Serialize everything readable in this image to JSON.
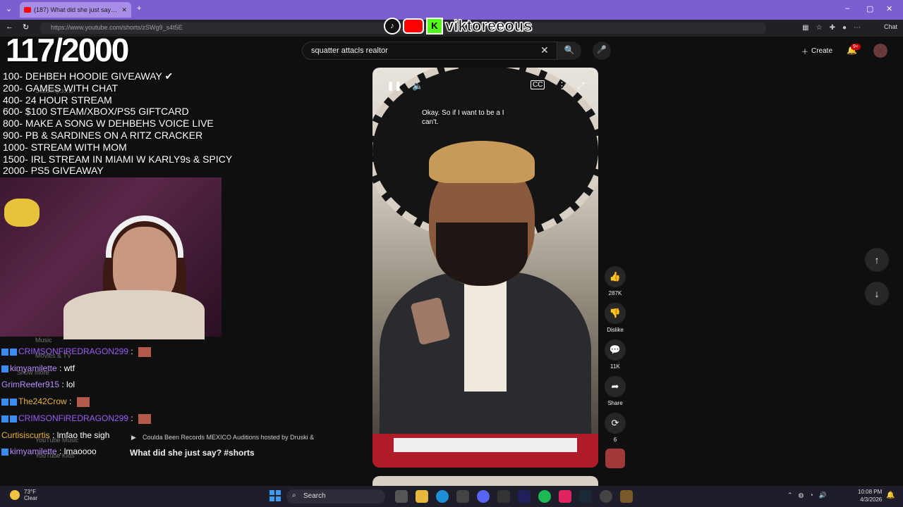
{
  "browser": {
    "tab_title": "(187) What did she just say? #",
    "url": "https://www.youtube.com/shorts/zSWg9_s4t5E",
    "chat_button": "Chat"
  },
  "youtube": {
    "search_value": "squatter attacls realtor",
    "create_label": "Create",
    "notif_count": "9+",
    "channel_line": "Coulda Been Records MEXICO Auditions hosted by Druski &",
    "video_title": "What did she just say? #shorts",
    "caption": "Okay. So if I want to be a I can't.",
    "actions": [
      {
        "icon": "thumb-up-icon",
        "glyph": "👍",
        "label": "287K"
      },
      {
        "icon": "thumb-down-icon",
        "glyph": "👎",
        "label": "Dislike"
      },
      {
        "icon": "comment-icon",
        "glyph": "💬",
        "label": "11K"
      },
      {
        "icon": "share-icon",
        "glyph": "➦",
        "label": "Share"
      },
      {
        "icon": "remix-icon",
        "glyph": "⟳",
        "label": "6"
      }
    ],
    "ghost_sidebar": [
      "Show more",
      "Music",
      "Movies & TV",
      "YouTube Music",
      "YouTube Kids",
      "Subscriptions"
    ]
  },
  "overlay": {
    "counter": "117/2000",
    "brand": "viktoreeous",
    "goals": [
      "100- DEHBEH HOODIE GIVEAWAY ✔",
      "200- GAMES WITH CHAT",
      "400- 24 HOUR STREAM",
      "600- $100 STEAM/XBOX/PS5 GIFTCARD",
      "800- MAKE A SONG W DEHBEHS VOICE LIVE",
      "900- PB & SARDINES ON A RITZ CRACKER",
      "1000- STREAM WITH MOM",
      "1500- IRL STREAM IN MIAMI W KARLY9s & SPICY",
      "2000- PS5 GIVEAWAY"
    ]
  },
  "chat": [
    {
      "user": "CRIMSONFiREDRAGON299",
      "msg": "",
      "color": "#9b5cf6",
      "badges": 2,
      "emote": true
    },
    {
      "user": "kimyamilette",
      "msg": "wtf",
      "color": "#b88cff",
      "badges": 1,
      "emote": false
    },
    {
      "user": "GrimReefer915",
      "msg": "lol",
      "color": "#b88cff",
      "badges": 0,
      "emote": false
    },
    {
      "user": "The242Crow",
      "msg": "",
      "color": "#e8b23a",
      "badges": 2,
      "emote": true
    },
    {
      "user": "CRIMSONFiREDRAGON299",
      "msg": "",
      "color": "#9b5cf6",
      "badges": 2,
      "emote": true
    },
    {
      "user": "Curtisiscurtis",
      "msg": "lmfao the sigh",
      "color": "#e8b23a",
      "badges": 0,
      "emote": false
    },
    {
      "user": "kimyamilette",
      "msg": "lmaoooo",
      "color": "#b88cff",
      "badges": 1,
      "emote": false
    }
  ],
  "taskbar": {
    "temp": "73°F",
    "condition": "Clear",
    "search_label": "Search",
    "time": "10:08 PM",
    "date": "4/3/2026"
  },
  "colors": {
    "tab_bar": "#7b5fd0",
    "yt_bg": "#0f0f0f",
    "accent_red": "#ff0000"
  }
}
